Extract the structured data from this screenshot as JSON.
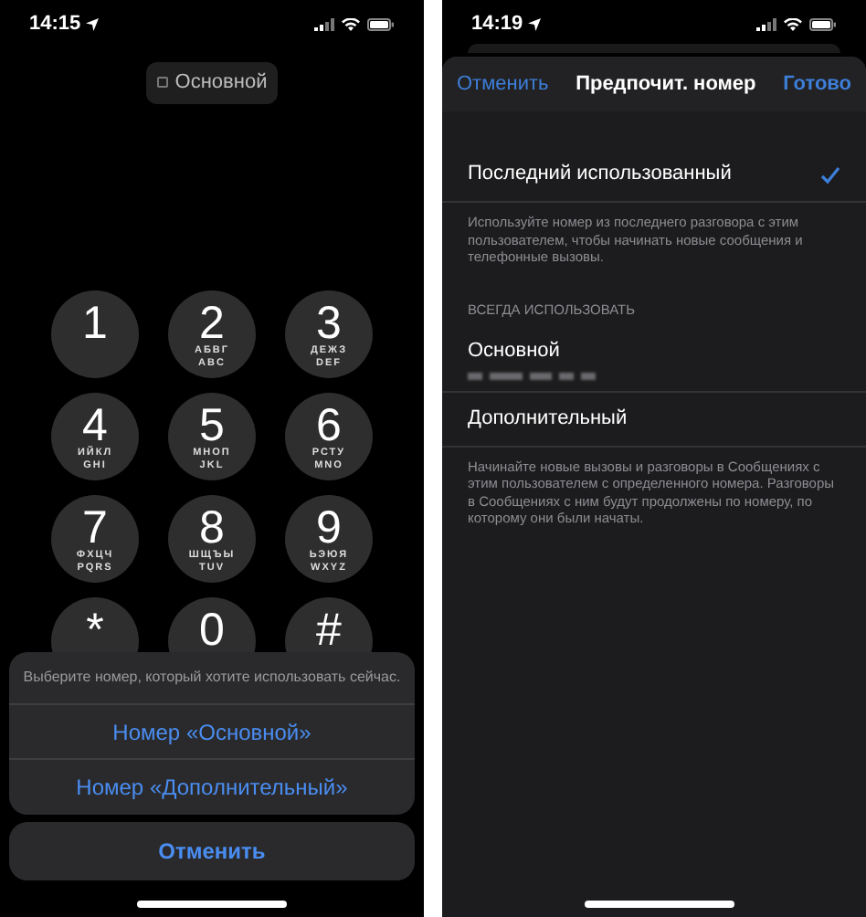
{
  "left_screen": {
    "status_bar": {
      "time": "14:15"
    },
    "line_label": "Основной",
    "keypad": [
      {
        "digit": "1"
      },
      {
        "digit": "2",
        "letters": [
          "АБВГ",
          "ABC"
        ]
      },
      {
        "digit": "3",
        "letters": [
          "ДЕЖЗ",
          "DEF"
        ]
      },
      {
        "digit": "4",
        "letters": [
          "ИЙКЛ",
          "GHI"
        ]
      },
      {
        "digit": "5",
        "letters": [
          "МНОП",
          "JKL"
        ]
      },
      {
        "digit": "6",
        "letters": [
          "РСТУ",
          "MNO"
        ]
      },
      {
        "digit": "7",
        "letters": [
          "ФХЦЧ",
          "PQRS"
        ]
      },
      {
        "digit": "8",
        "letters": [
          "ШЩЪЫ",
          "TUV"
        ]
      },
      {
        "digit": "9",
        "letters": [
          "ЬЭЮЯ",
          "WXYZ"
        ]
      },
      {
        "digit": "*"
      },
      {
        "digit": "0"
      },
      {
        "digit": "#"
      }
    ],
    "action_sheet": {
      "message": "Выберите номер, который хотите использовать сейчас.",
      "options": [
        "Номер «Основной»",
        "Номер «Дополнительный»"
      ],
      "cancel": "Отменить"
    }
  },
  "right_screen": {
    "status_bar": {
      "time": "14:19"
    },
    "nav": {
      "cancel": "Отменить",
      "title": "Предпочит. номер",
      "done": "Готово"
    },
    "sections": [
      {
        "options": [
          {
            "label": "Последний использованный",
            "selected": true,
            "redacted": false
          }
        ],
        "footer": "Используйте номер из последнего разговора с этим пользователем, чтобы начинать новые сообщения и телефонные вызовы."
      },
      {
        "header": "ВСЕГДА ИСПОЛЬЗОВАТЬ",
        "options": [
          {
            "label": "Основной",
            "selected": false,
            "redacted": true
          },
          {
            "label": "Дополнительный",
            "selected": false,
            "redacted": false
          }
        ],
        "footer": "Начинайте новые вызовы и разговоры в Сообщениях с этим пользователем с определенного номера. Разговоры в Сообщениях с ним будут продолжены по номеру, по которому они были начаты."
      }
    ]
  }
}
